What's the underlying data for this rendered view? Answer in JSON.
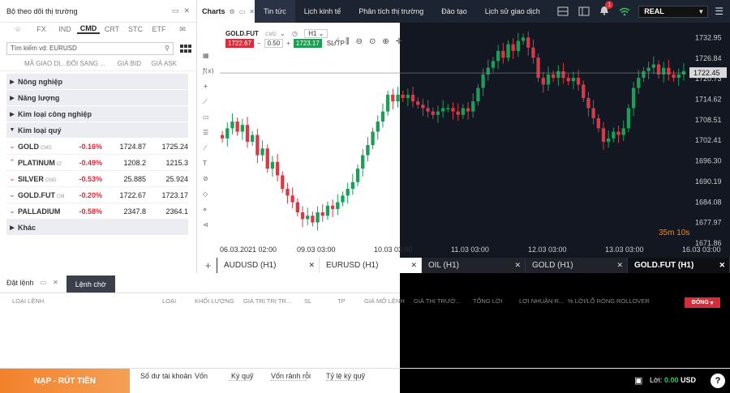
{
  "watchlist": {
    "title": "Bộ theo dõi thị trường",
    "asset_tabs": [
      "☆",
      "FX",
      "IND",
      "CMD",
      "CRT",
      "STC",
      "ETF",
      "✉"
    ],
    "active_tab": "CMD",
    "search_placeholder": "Tìm kiếm vd: EURUSD",
    "columns": [
      "MÃ GIAO DỊ...",
      "ĐỔI SANG ...",
      "GIÁ BID",
      "GIÁ ASK"
    ],
    "groups_before": [
      "Nông nghiệp",
      "Năng lượng",
      "Kim loại công nghiệp"
    ],
    "open_group": "Kim loại quý",
    "rows": [
      {
        "dir": "down",
        "name": "GOLD",
        "tag": "CMD",
        "change": "-0.16%",
        "bid": "1724.87",
        "ask": "1725.24"
      },
      {
        "dir": "up",
        "name": "PLATINUM",
        "tag": "Cf",
        "change": "-0.49%",
        "bid": "1208.2",
        "ask": "1215.3"
      },
      {
        "dir": "down",
        "name": "SILVER",
        "tag": "CMD",
        "change": "-0.53%",
        "bid": "25.885",
        "ask": "25.924"
      },
      {
        "dir": "down",
        "name": "GOLD.FUT",
        "tag": "CM",
        "change": "-0.20%",
        "bid": "1722.67",
        "ask": "1723.17"
      },
      {
        "dir": "down",
        "name": "PALLADIUM",
        "tag": "",
        "change": "-0.58%",
        "bid": "2347.8",
        "ask": "2364.1"
      }
    ],
    "groups_after": [
      "Khác"
    ]
  },
  "topnav": {
    "charts_label": "Charts",
    "items": [
      "Tin tức",
      "Lịch kinh tế",
      "Phân tích thị trường",
      "Đào tạo",
      "Lịch sử giao dịch"
    ],
    "account": "REAL",
    "bell_count": "1"
  },
  "chart": {
    "symbol": "GOLD.FUT",
    "symbol_tag": "CMD",
    "timeframe": "H1",
    "sell_price": "1722.67",
    "lot": "0.50",
    "buy_price": "1723.17",
    "sltp": "SL/TP",
    "countdown": "35m 10s",
    "current_price": "1722.45"
  },
  "chart_data": {
    "type": "candlestick",
    "symbol": "GOLD.FUT",
    "timeframe": "H1",
    "x_tick_labels": [
      "06.03.2021 02:00",
      "09.03 03:00",
      "10.03 03:00",
      "11.03 03:00",
      "12.03 03:00",
      "13.03 03:00",
      "16.03 03:00"
    ],
    "y_tick_labels": [
      "1732.95",
      "1726.84",
      "1720.73",
      "1714.62",
      "1708.51",
      "1702.41",
      "1696.30",
      "1690.19",
      "1684.08",
      "1677.97",
      "1671.86"
    ],
    "ylim": [
      1671.86,
      1735.0
    ],
    "current_price": 1722.45,
    "close_series": [
      1703,
      1706,
      1708,
      1705,
      1707,
      1702,
      1704,
      1698,
      1700,
      1694,
      1696,
      1692,
      1688,
      1686,
      1684,
      1681,
      1679,
      1680,
      1678,
      1681,
      1680,
      1683,
      1682,
      1684,
      1686,
      1688,
      1690,
      1694,
      1698,
      1701,
      1705,
      1708,
      1711,
      1716,
      1714,
      1716,
      1715,
      1716,
      1714,
      1713,
      1712,
      1711,
      1710,
      1711,
      1712,
      1712,
      1711,
      1710,
      1712,
      1711,
      1714,
      1718,
      1722,
      1724,
      1726,
      1729,
      1727,
      1731,
      1729,
      1732,
      1733,
      1730,
      1727,
      1721,
      1719,
      1722,
      1721,
      1723,
      1721,
      1720,
      1721,
      1719,
      1715,
      1712,
      1709,
      1706,
      1702,
      1703,
      1705,
      1704,
      1706,
      1712,
      1718,
      1721,
      1723,
      1724,
      1725,
      1722,
      1724,
      1722,
      1721,
      1722,
      1723
    ]
  },
  "chart_tabs": [
    {
      "label": "AUDUSD (H1)",
      "theme": "light"
    },
    {
      "label": "EURUSD (H1)",
      "theme": "light"
    },
    {
      "label": "OIL (H1)",
      "theme": "dark"
    },
    {
      "label": "GOLD (H1)",
      "theme": "dark"
    },
    {
      "label": "GOLD.FUT (H1)",
      "theme": "active"
    }
  ],
  "orders": {
    "tab1": "Đặt lệnh",
    "tab2": "Lệnh chờ",
    "columns": [
      "LOẠI LỆNH",
      "LOẠI",
      "KHỐI LƯỢNG",
      "GIÁ TRỊ TRỊ TR...",
      "SL",
      "TP",
      "GIÁ MỞ LỆNH",
      "GIÁ THỊ TRƯỜ...",
      "TỔNG LỜI",
      "LỢI NHUẬN R...",
      "% LỜI/LỖ RÒNG",
      "ROLLOVER"
    ],
    "close_button": "ĐÓNG"
  },
  "footer": {
    "deposit_button": "NẠP - RÚT TIỀN",
    "labels": [
      "Số dư tài khoản",
      "Vốn",
      "Ký quỹ",
      "Vốn rảnh rỗi",
      "Tỷ lệ ký quỹ"
    ],
    "profit_label": "Lời:",
    "profit_value": "0.00",
    "currency": "USD",
    "help": "?"
  }
}
